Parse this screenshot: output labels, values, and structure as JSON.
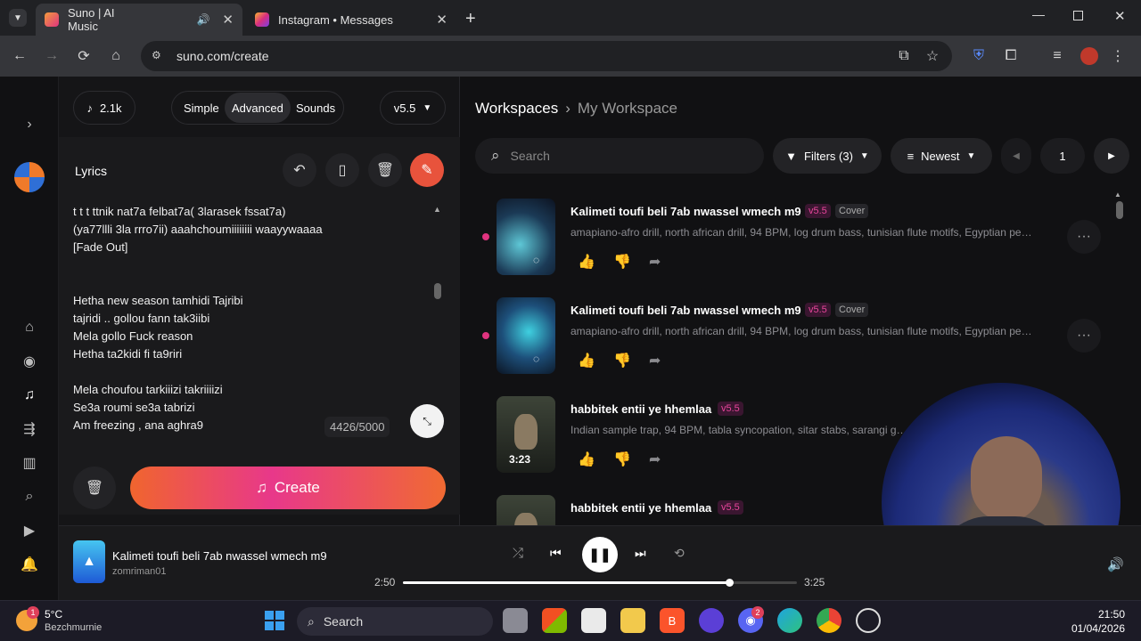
{
  "tabs": [
    {
      "title": "Suno | AI Music",
      "active": true
    },
    {
      "title": "Instagram • Messages",
      "active": false
    }
  ],
  "omnibox": {
    "url": "suno.com/create"
  },
  "create": {
    "credits": "2.1k",
    "modes": [
      "Simple",
      "Advanced",
      "Sounds"
    ],
    "selected_mode": "Advanced",
    "model": "v5.5",
    "lyrics_label": "Lyrics",
    "char_count": "4426/5000",
    "create_label": "Create",
    "lyrics": [
      "t t t ttnik nat7a felbat7a( 3larasek fssat7a)",
      "(ya77llli 3la rrro7ii) aaahchoumiiiiiiii waayywaaaa",
      " [Fade Out]",
      "",
      "",
      "Hetha new season tamhidi Tajribi",
      "tajridi .. gollou fann tak3iibi",
      "Mela gollo Fuck reason",
      "Hetha ta2kidi fi ta9riri",
      "",
      "Mela  choufou tarkiiizi takriiiizi",
      "Se3a roumi se3a tabrizi",
      "Am freezing , ana aghra9"
    ]
  },
  "workspace": {
    "breadcrumb_root": "Workspaces",
    "breadcrumb_current": "My Workspace",
    "search_placeholder": "Search",
    "filters_label": "Filters (3)",
    "sort_label": "Newest",
    "page": "1"
  },
  "songs": [
    {
      "title": "Kalimeti toufi beli 7ab nwassel wmech m9",
      "version": "v5.5",
      "cover": "Cover",
      "tags": "amapiano-afro drill, north african drill, 94 BPM, log drum bass, tunisian flute motifs, Egyptian percussio...",
      "duration": ""
    },
    {
      "title": "Kalimeti toufi beli 7ab nwassel wmech m9",
      "version": "v5.5",
      "cover": "Cover",
      "tags": "amapiano-afro drill, north african drill, 94 BPM, log drum bass, tunisian flute motifs, Egyptian percussio...",
      "duration": ""
    },
    {
      "title": "habbitek entii ye hhemlaa",
      "version": "v5.5",
      "cover": "",
      "tags": "Indian sample trap, 94 BPM, tabla syncopation, sitar stabs, sarangi glissand",
      "duration": "3:23"
    },
    {
      "title": "habbitek entii ye hhemlaa",
      "version": "v5.5",
      "cover": "",
      "tags": "",
      "duration": ""
    }
  ],
  "player": {
    "title": "Kalimeti toufi beli 7ab nwassel wmech m9",
    "artist": "zomriman01",
    "elapsed": "2:50",
    "total": "3:25",
    "progress": 0.829
  },
  "taskbar": {
    "weather_temp": "5°C",
    "weather_place": "Bezchmurnie",
    "weather_badge": "1",
    "search_label": "Search",
    "discord_badge": "2",
    "time": "21:50",
    "date": "01/04/2026"
  },
  "colors": {
    "accent_orange": "#f0582a",
    "accent_pink": "#e0337f",
    "badge_v55": "#e8459b"
  }
}
